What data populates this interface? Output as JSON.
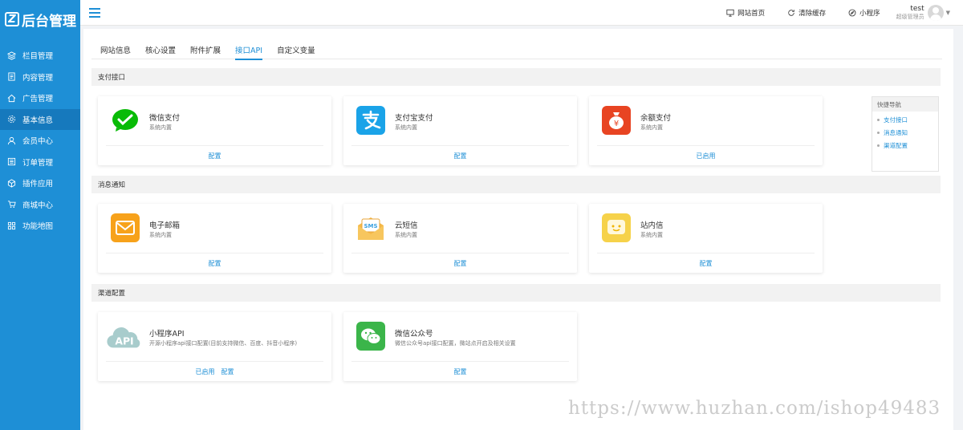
{
  "app": {
    "logo_text": "后台管理"
  },
  "sidebar": {
    "items": [
      {
        "label": "栏目管理",
        "icon": "layers-icon"
      },
      {
        "label": "内容管理",
        "icon": "document-icon"
      },
      {
        "label": "广告管理",
        "icon": "home-icon"
      },
      {
        "label": "基本信息",
        "icon": "gear-icon",
        "active": true
      },
      {
        "label": "会员中心",
        "icon": "user-icon"
      },
      {
        "label": "订单管理",
        "icon": "list-icon"
      },
      {
        "label": "插件应用",
        "icon": "cube-icon"
      },
      {
        "label": "商城中心",
        "icon": "cart-icon"
      },
      {
        "label": "功能地图",
        "icon": "grid-icon"
      }
    ]
  },
  "topbar": {
    "links": [
      {
        "label": "网站首页",
        "icon": "monitor-icon"
      },
      {
        "label": "清除缓存",
        "icon": "refresh-icon"
      },
      {
        "label": "小程序",
        "icon": "compass-icon"
      }
    ],
    "user": {
      "name": "test",
      "role": "超级管理员"
    }
  },
  "tabs": [
    {
      "label": "网站信息",
      "active": false
    },
    {
      "label": "核心设置",
      "active": false
    },
    {
      "label": "附件扩展",
      "active": false
    },
    {
      "label": "接口API",
      "active": true
    },
    {
      "label": "自定义变量",
      "active": false
    }
  ],
  "sections": [
    {
      "title": "支付接口",
      "cards": [
        {
          "title": "微信支付",
          "desc": "系统内置",
          "actions": [
            "配置"
          ],
          "icon": "wechat-pay-icon",
          "color": "#09bb07"
        },
        {
          "title": "支付宝支付",
          "desc": "系统内置",
          "actions": [
            "配置"
          ],
          "icon": "alipay-icon",
          "color": "#1aa3e8"
        },
        {
          "title": "余额支付",
          "desc": "系统内置",
          "actions": [
            "已启用"
          ],
          "icon": "balance-icon",
          "color": "#e84422"
        }
      ]
    },
    {
      "title": "消息通知",
      "cards": [
        {
          "title": "电子邮箱",
          "desc": "系统内置",
          "actions": [
            "配置"
          ],
          "icon": "email-icon",
          "color": "#f7a21b"
        },
        {
          "title": "云短信",
          "desc": "系统内置",
          "actions": [
            "配置"
          ],
          "icon": "sms-icon",
          "color": "#f5b949"
        },
        {
          "title": "站内信",
          "desc": "系统内置",
          "actions": [
            "配置"
          ],
          "icon": "message-icon",
          "color": "#f6d24a"
        }
      ]
    },
    {
      "title": "渠道配置",
      "cards": [
        {
          "title": "小程序API",
          "desc": "开源小程序api接口配置(目前支持微信、百度、抖音小程序)",
          "actions": [
            "已启用",
            "配置"
          ],
          "icon": "cloud-api-icon",
          "color": "#9fc8c8",
          "icon_text": "API"
        },
        {
          "title": "微信公众号",
          "desc": "微信公众号api接口配置，微站点开启及相关设置",
          "actions": [
            "配置"
          ],
          "icon": "wechat-icon",
          "color": "#3bb54a"
        }
      ]
    }
  ],
  "quick_nav": {
    "title": "快捷导航",
    "items": [
      "支付接口",
      "消息通知",
      "渠道配置"
    ]
  },
  "watermark": "https://www.huzhan.com/ishop49483"
}
